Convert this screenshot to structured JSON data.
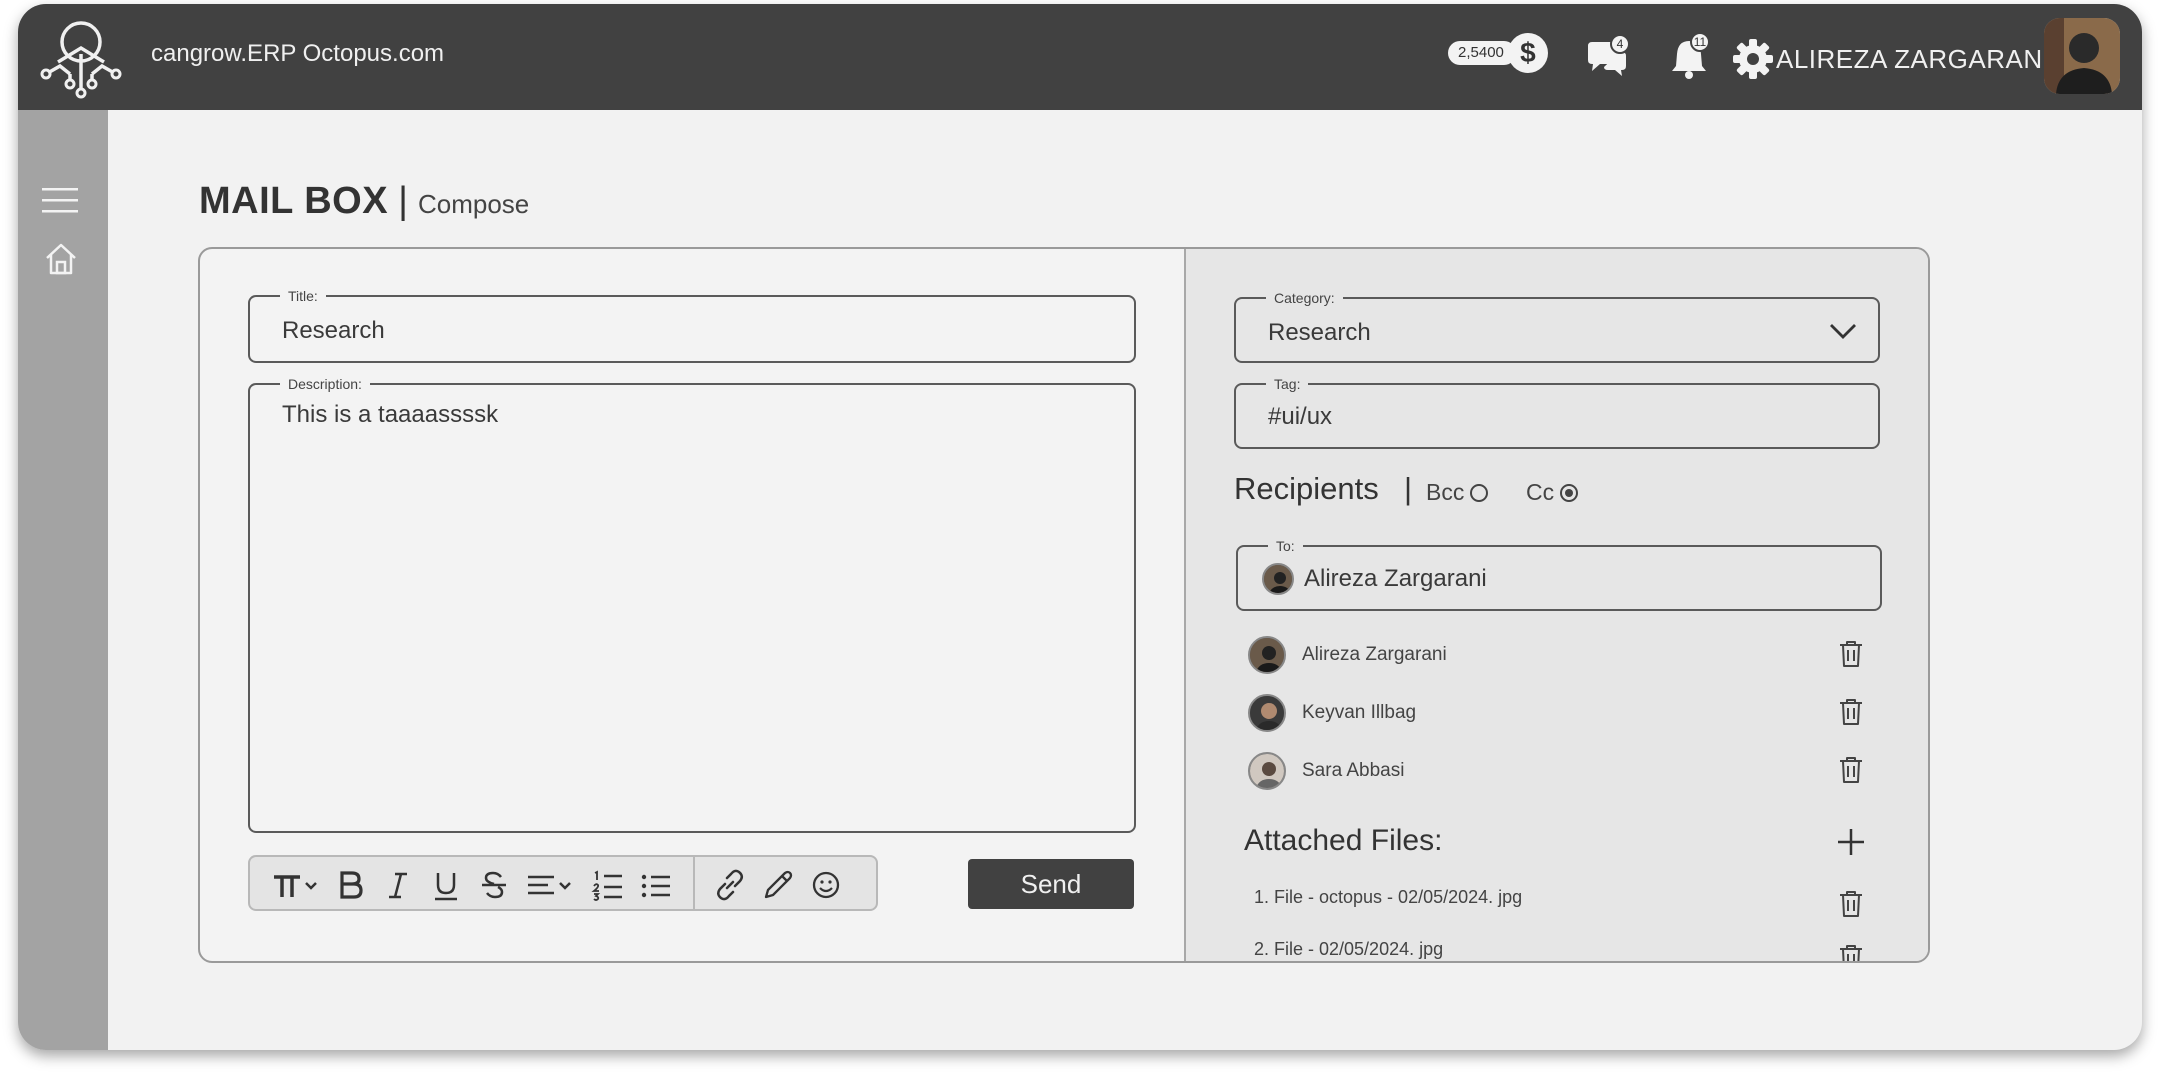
{
  "header": {
    "app_title": "cangrow.ERP Octopus.com",
    "coin_amount": "2,5400",
    "coin_symbol": "$",
    "messages_count": "4",
    "notifications_count": "11",
    "username": "ALIREZA ZARGARANI"
  },
  "sidebar": {
    "items": [
      {
        "icon": "menu-icon"
      },
      {
        "icon": "home-icon"
      }
    ]
  },
  "page": {
    "title": "MAIL BOX",
    "separator": "|",
    "subtitle": "Compose"
  },
  "compose": {
    "title_label": "Title:",
    "title_value": "Research",
    "description_label": "Description:",
    "description_value": "This is a taaaassssk",
    "toolbar": [
      "text-size-icon",
      "bold-icon",
      "italic-icon",
      "underline-icon",
      "strikethrough-icon",
      "align-icon",
      "ordered-list-icon",
      "bullet-list-icon",
      "link-icon",
      "pen-icon",
      "emoji-icon"
    ],
    "send_label": "Send"
  },
  "details": {
    "category_label": "Category:",
    "category_value": "Research",
    "tag_label": "Tag:",
    "tag_value": "#ui/ux",
    "recipients_title": "Recipients",
    "recipients_sep": "|",
    "bcc_label": "Bcc",
    "bcc_selected": false,
    "cc_label": "Cc",
    "cc_selected": true,
    "to_label": "To:",
    "to_value": "Alireza Zargarani",
    "recipients": [
      {
        "name": "Alireza Zargarani"
      },
      {
        "name": "Keyvan Illbag"
      },
      {
        "name": "Sara Abbasi"
      }
    ],
    "attached_title": "Attached Files:",
    "files": [
      {
        "name": "1. File - octopus - 02/05/2024. jpg"
      },
      {
        "name": "2. File - 02/05/2024. jpg"
      }
    ]
  },
  "colors": {
    "topbar": "#414141",
    "sidebar": "#a3a3a3",
    "background": "#f2f2f2",
    "button": "#414141"
  }
}
